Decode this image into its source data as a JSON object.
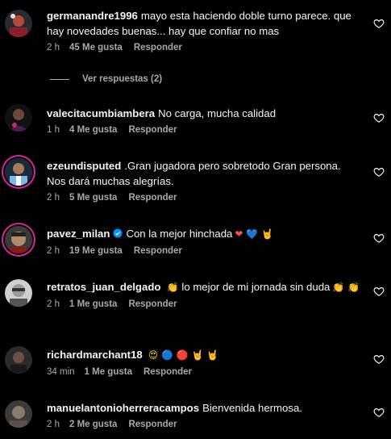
{
  "labels": {
    "like": "Me gusta",
    "reply": "Responder"
  },
  "view_replies": "Ver respuestas (2)",
  "comments": [
    {
      "user": "germanandre1996",
      "text": "mayo esta haciendo doble turno parece. que hay novedades buenas... hay que confiar no mas",
      "time": "2 h",
      "likes": "45 Me gusta",
      "emojis": ""
    },
    {
      "user": "valecitacumbiambera",
      "text": "No carga, mucha calidad",
      "time": "1 h",
      "likes": "4 Me gusta",
      "emojis": ""
    },
    {
      "user": "ezeundisputed",
      "text": ".Gran jugadora pero sobretodo Gran persona. Nos dará muchas alegrías.",
      "time": "2 h",
      "likes": "5 Me gusta",
      "emojis": ""
    },
    {
      "user": "pavez_milan",
      "text": "Con la mejor hinchada",
      "time": "2 h",
      "likes": "19 Me gusta",
      "emojis": "❤ 💙 🤘",
      "verified": true
    },
    {
      "user": "retratos_juan_delgado",
      "text": "lo mejor de mi jornada sin duda",
      "time": "2 h",
      "likes": "1 Me gusta",
      "emojis_before": "👏",
      "emojis": "👏 👏"
    },
    {
      "user": "richardmarchant18",
      "text": "",
      "time": "34 min",
      "likes": "1 Me gusta",
      "emojis": "😍 🔵 🔴 🤘 🤘"
    },
    {
      "user": "manuelantonioherreracampos",
      "text": "Bienvenida hermosa.",
      "time": "2 h",
      "likes": "2 Me gusta",
      "emojis": ""
    }
  ],
  "colors": {
    "background": "#000000",
    "text": "#f5f5f5",
    "muted": "#a8a8a8",
    "verified": "#0095f6",
    "story_ring": "#d6249f"
  }
}
